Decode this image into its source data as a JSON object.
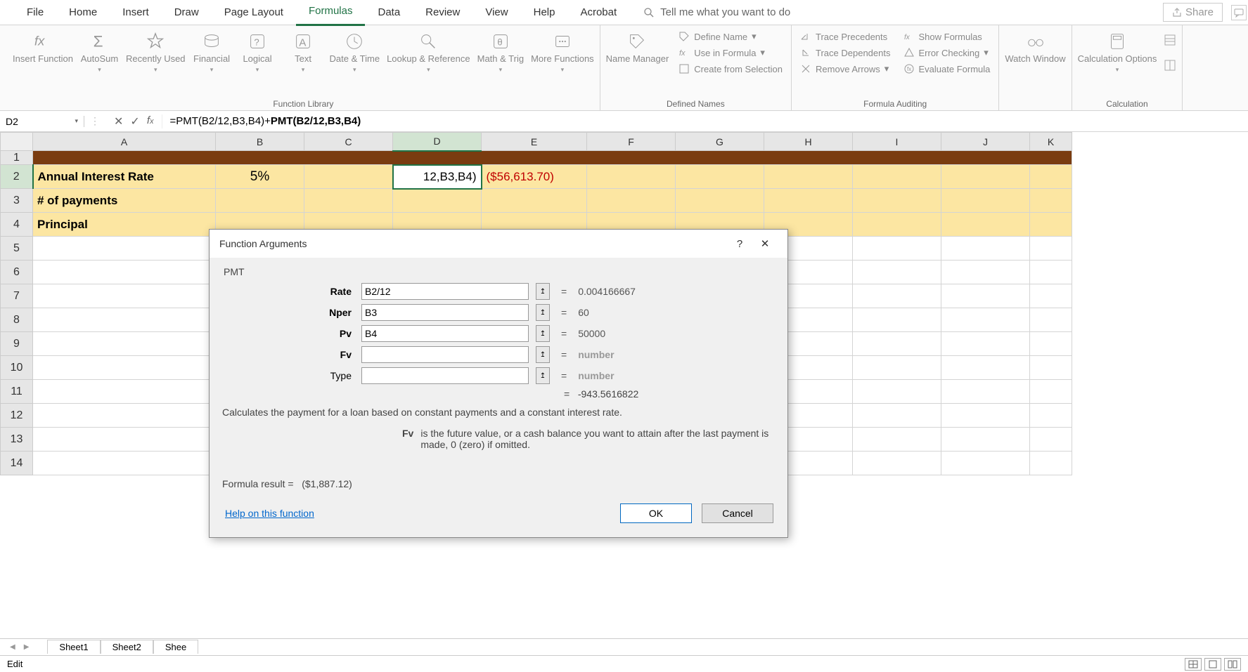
{
  "tabs": {
    "file": "File",
    "home": "Home",
    "insert": "Insert",
    "draw": "Draw",
    "page_layout": "Page Layout",
    "formulas": "Formulas",
    "data": "Data",
    "review": "Review",
    "view": "View",
    "help": "Help",
    "acrobat": "Acrobat"
  },
  "tell_me": "Tell me what you want to do",
  "share": "Share",
  "ribbon": {
    "insert_function": "Insert Function",
    "autosum": "AutoSum",
    "recently_used": "Recently Used",
    "financial": "Financial",
    "logical": "Logical",
    "text": "Text",
    "date_time": "Date & Time",
    "lookup_ref": "Lookup & Reference",
    "math_trig": "Math & Trig",
    "more_functions": "More Functions",
    "function_library": "Function Library",
    "name_manager": "Name Manager",
    "define_name": "Define Name",
    "use_in_formula": "Use in Formula",
    "create_from_selection": "Create from Selection",
    "defined_names": "Defined Names",
    "trace_precedents": "Trace Precedents",
    "trace_dependents": "Trace Dependents",
    "remove_arrows": "Remove Arrows",
    "show_formulas": "Show Formulas",
    "error_checking": "Error Checking",
    "evaluate_formula": "Evaluate Formula",
    "formula_auditing": "Formula Auditing",
    "watch_window": "Watch Window",
    "calc_options": "Calculation Options",
    "calculation": "Calculation"
  },
  "name_box": "D2",
  "formula_prefix": "=PMT(B2/12,B3,B4)+",
  "formula_bold": "PMT(B2/12,B3,B4)",
  "columns": [
    "A",
    "B",
    "C",
    "D",
    "E",
    "F",
    "G",
    "H",
    "I",
    "J",
    "K"
  ],
  "rows": [
    "1",
    "2",
    "3",
    "4",
    "5",
    "6",
    "7",
    "8",
    "9",
    "10",
    "11",
    "12",
    "13",
    "14"
  ],
  "cells": {
    "a2": "Annual Interest Rate",
    "b2": "5%",
    "d2": "12,B3,B4)",
    "e2": "($56,613.70)",
    "a3": "# of payments",
    "a4": "Principal"
  },
  "dialog": {
    "title": "Function Arguments",
    "func": "PMT",
    "args": {
      "rate_label": "Rate",
      "rate_val": "B2/12",
      "rate_res": "0.004166667",
      "nper_label": "Nper",
      "nper_val": "B3",
      "nper_res": "60",
      "pv_label": "Pv",
      "pv_val": "B4",
      "pv_res": "50000",
      "fv_label": "Fv",
      "fv_val": "",
      "fv_res": "number",
      "type_label": "Type",
      "type_val": "",
      "type_res": "number"
    },
    "overall_result": "-943.5616822",
    "desc1": "Calculates the payment for a loan based on constant payments and a constant interest rate.",
    "desc2_label": "Fv",
    "desc2_text": "is the future value, or a cash balance you want to attain after the last payment is made, 0 (zero) if omitted.",
    "formula_result_label": "Formula result =",
    "formula_result": "($1,887.12)",
    "help": "Help on this function",
    "ok": "OK",
    "cancel": "Cancel"
  },
  "sheets": {
    "s1": "Sheet1",
    "s2": "Sheet2",
    "s3": "Shee"
  },
  "status": "Edit"
}
